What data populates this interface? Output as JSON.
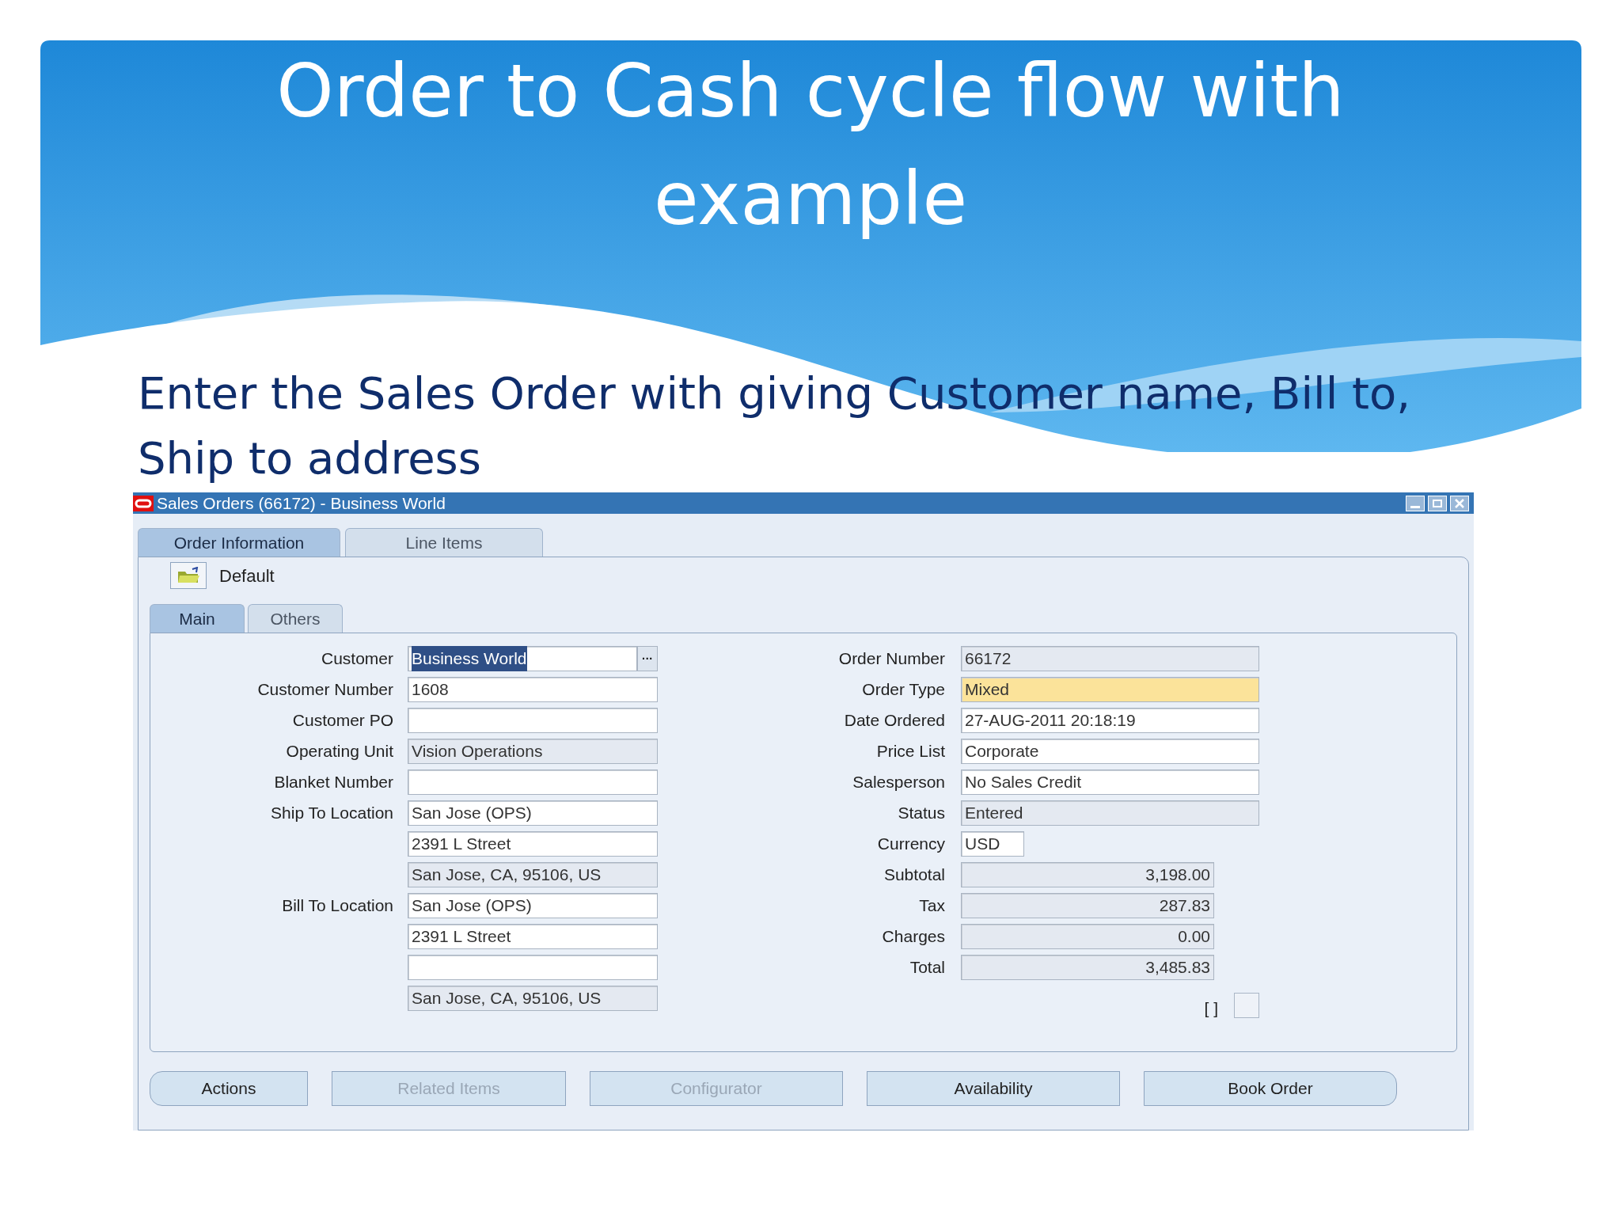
{
  "slide": {
    "title": "Order to Cash cycle flow with example",
    "subtitle": "Enter the Sales Order with giving Customer name, Bill to, Ship to address"
  },
  "window": {
    "title": "Sales Orders (66172) - Business World"
  },
  "tabs": [
    {
      "label": "Order Information",
      "selected": true
    },
    {
      "label": "Line Items",
      "selected": false
    }
  ],
  "toolbar": {
    "label": "Default"
  },
  "subtabs": [
    {
      "label": "Main",
      "selected": true
    },
    {
      "label": "Others",
      "selected": false
    }
  ],
  "left_fields": [
    {
      "label": "Customer",
      "values": [
        {
          "value": "Business World",
          "readonly": false,
          "highlighted": true,
          "lookup": "···"
        }
      ]
    },
    {
      "label": "Customer Number",
      "values": [
        {
          "value": "1608",
          "readonly": false
        }
      ]
    },
    {
      "label": "Customer PO",
      "values": [
        {
          "readonly": false
        }
      ]
    },
    {
      "label": "Operating Unit",
      "values": [
        {
          "value": "Vision Operations",
          "readonly": true
        }
      ]
    },
    {
      "label": "Blanket Number",
      "values": [
        {
          "readonly": false
        }
      ]
    },
    {
      "label": "Ship To Location",
      "values": [
        {
          "value": "San Jose (OPS)",
          "readonly": false
        },
        {
          "value": "2391 L Street",
          "readonly": false
        },
        {
          "value": "San Jose, CA, 95106, US",
          "readonly": true
        }
      ]
    },
    {
      "label": "Bill To Location",
      "values": [
        {
          "value": "San Jose (OPS)",
          "readonly": false
        },
        {
          "value": "2391 L Street",
          "readonly": false
        },
        {
          "readonly": false
        },
        {
          "value": "San Jose, CA, 95106, US",
          "readonly": true
        }
      ]
    }
  ],
  "right_fields": [
    {
      "label": "Order Number",
      "value": "66172",
      "readonly": true,
      "required": false,
      "kind": "text"
    },
    {
      "label": "Order Type",
      "value": "Mixed",
      "required": true,
      "kind": "text"
    },
    {
      "label": "Date Ordered",
      "value": "27-AUG-2011 20:18:19",
      "readonly": false,
      "required": false,
      "kind": "text"
    },
    {
      "label": "Price List",
      "value": "Corporate",
      "readonly": false,
      "required": false,
      "kind": "text"
    },
    {
      "label": "Salesperson",
      "value": "No Sales Credit",
      "readonly": false,
      "required": false,
      "kind": "text"
    },
    {
      "label": "Status",
      "value": "Entered",
      "readonly": true,
      "required": false,
      "kind": "text"
    },
    {
      "label": "Currency",
      "value": "USD",
      "readonly": false,
      "required": false,
      "kind": "code"
    },
    {
      "label": "Subtotal",
      "value": "3,198.00",
      "readonly": true,
      "required": false,
      "kind": "amount"
    },
    {
      "label": "Tax",
      "value": "287.83",
      "readonly": true,
      "required": false,
      "kind": "amount"
    },
    {
      "label": "Charges",
      "value": "0.00",
      "readonly": true,
      "required": false,
      "kind": "amount"
    },
    {
      "label": "Total",
      "value": "3,485.83",
      "readonly": true,
      "required": false,
      "kind": "amount"
    }
  ],
  "flag": {
    "label": "[ ]",
    "checked": false
  },
  "buttons": [
    {
      "label": "Actions",
      "disabled": false
    },
    {
      "label": "Related Items",
      "disabled": true
    },
    {
      "label": "Configurator",
      "disabled": true
    },
    {
      "label": "Availability",
      "disabled": false
    },
    {
      "label": "Book Order",
      "disabled": false
    }
  ]
}
